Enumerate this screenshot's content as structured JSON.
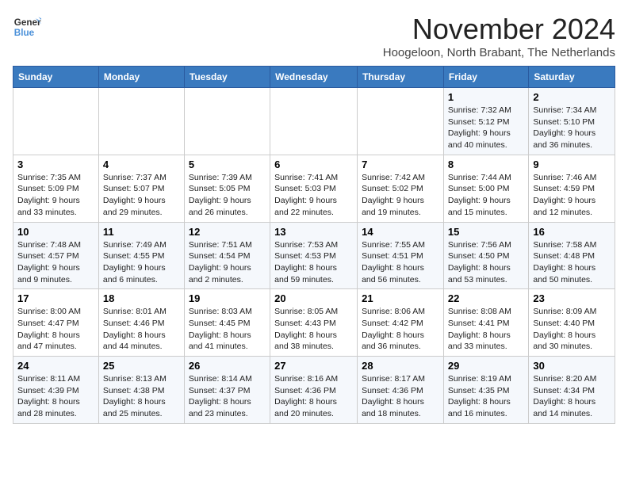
{
  "logo": {
    "line1": "General",
    "line2": "Blue"
  },
  "title": "November 2024",
  "subtitle": "Hoogeloon, North Brabant, The Netherlands",
  "weekdays": [
    "Sunday",
    "Monday",
    "Tuesday",
    "Wednesday",
    "Thursday",
    "Friday",
    "Saturday"
  ],
  "weeks": [
    [
      {
        "day": "",
        "info": ""
      },
      {
        "day": "",
        "info": ""
      },
      {
        "day": "",
        "info": ""
      },
      {
        "day": "",
        "info": ""
      },
      {
        "day": "",
        "info": ""
      },
      {
        "day": "1",
        "info": "Sunrise: 7:32 AM\nSunset: 5:12 PM\nDaylight: 9 hours and 40 minutes."
      },
      {
        "day": "2",
        "info": "Sunrise: 7:34 AM\nSunset: 5:10 PM\nDaylight: 9 hours and 36 minutes."
      }
    ],
    [
      {
        "day": "3",
        "info": "Sunrise: 7:35 AM\nSunset: 5:09 PM\nDaylight: 9 hours and 33 minutes."
      },
      {
        "day": "4",
        "info": "Sunrise: 7:37 AM\nSunset: 5:07 PM\nDaylight: 9 hours and 29 minutes."
      },
      {
        "day": "5",
        "info": "Sunrise: 7:39 AM\nSunset: 5:05 PM\nDaylight: 9 hours and 26 minutes."
      },
      {
        "day": "6",
        "info": "Sunrise: 7:41 AM\nSunset: 5:03 PM\nDaylight: 9 hours and 22 minutes."
      },
      {
        "day": "7",
        "info": "Sunrise: 7:42 AM\nSunset: 5:02 PM\nDaylight: 9 hours and 19 minutes."
      },
      {
        "day": "8",
        "info": "Sunrise: 7:44 AM\nSunset: 5:00 PM\nDaylight: 9 hours and 15 minutes."
      },
      {
        "day": "9",
        "info": "Sunrise: 7:46 AM\nSunset: 4:59 PM\nDaylight: 9 hours and 12 minutes."
      }
    ],
    [
      {
        "day": "10",
        "info": "Sunrise: 7:48 AM\nSunset: 4:57 PM\nDaylight: 9 hours and 9 minutes."
      },
      {
        "day": "11",
        "info": "Sunrise: 7:49 AM\nSunset: 4:55 PM\nDaylight: 9 hours and 6 minutes."
      },
      {
        "day": "12",
        "info": "Sunrise: 7:51 AM\nSunset: 4:54 PM\nDaylight: 9 hours and 2 minutes."
      },
      {
        "day": "13",
        "info": "Sunrise: 7:53 AM\nSunset: 4:53 PM\nDaylight: 8 hours and 59 minutes."
      },
      {
        "day": "14",
        "info": "Sunrise: 7:55 AM\nSunset: 4:51 PM\nDaylight: 8 hours and 56 minutes."
      },
      {
        "day": "15",
        "info": "Sunrise: 7:56 AM\nSunset: 4:50 PM\nDaylight: 8 hours and 53 minutes."
      },
      {
        "day": "16",
        "info": "Sunrise: 7:58 AM\nSunset: 4:48 PM\nDaylight: 8 hours and 50 minutes."
      }
    ],
    [
      {
        "day": "17",
        "info": "Sunrise: 8:00 AM\nSunset: 4:47 PM\nDaylight: 8 hours and 47 minutes."
      },
      {
        "day": "18",
        "info": "Sunrise: 8:01 AM\nSunset: 4:46 PM\nDaylight: 8 hours and 44 minutes."
      },
      {
        "day": "19",
        "info": "Sunrise: 8:03 AM\nSunset: 4:45 PM\nDaylight: 8 hours and 41 minutes."
      },
      {
        "day": "20",
        "info": "Sunrise: 8:05 AM\nSunset: 4:43 PM\nDaylight: 8 hours and 38 minutes."
      },
      {
        "day": "21",
        "info": "Sunrise: 8:06 AM\nSunset: 4:42 PM\nDaylight: 8 hours and 36 minutes."
      },
      {
        "day": "22",
        "info": "Sunrise: 8:08 AM\nSunset: 4:41 PM\nDaylight: 8 hours and 33 minutes."
      },
      {
        "day": "23",
        "info": "Sunrise: 8:09 AM\nSunset: 4:40 PM\nDaylight: 8 hours and 30 minutes."
      }
    ],
    [
      {
        "day": "24",
        "info": "Sunrise: 8:11 AM\nSunset: 4:39 PM\nDaylight: 8 hours and 28 minutes."
      },
      {
        "day": "25",
        "info": "Sunrise: 8:13 AM\nSunset: 4:38 PM\nDaylight: 8 hours and 25 minutes."
      },
      {
        "day": "26",
        "info": "Sunrise: 8:14 AM\nSunset: 4:37 PM\nDaylight: 8 hours and 23 minutes."
      },
      {
        "day": "27",
        "info": "Sunrise: 8:16 AM\nSunset: 4:36 PM\nDaylight: 8 hours and 20 minutes."
      },
      {
        "day": "28",
        "info": "Sunrise: 8:17 AM\nSunset: 4:36 PM\nDaylight: 8 hours and 18 minutes."
      },
      {
        "day": "29",
        "info": "Sunrise: 8:19 AM\nSunset: 4:35 PM\nDaylight: 8 hours and 16 minutes."
      },
      {
        "day": "30",
        "info": "Sunrise: 8:20 AM\nSunset: 4:34 PM\nDaylight: 8 hours and 14 minutes."
      }
    ]
  ]
}
